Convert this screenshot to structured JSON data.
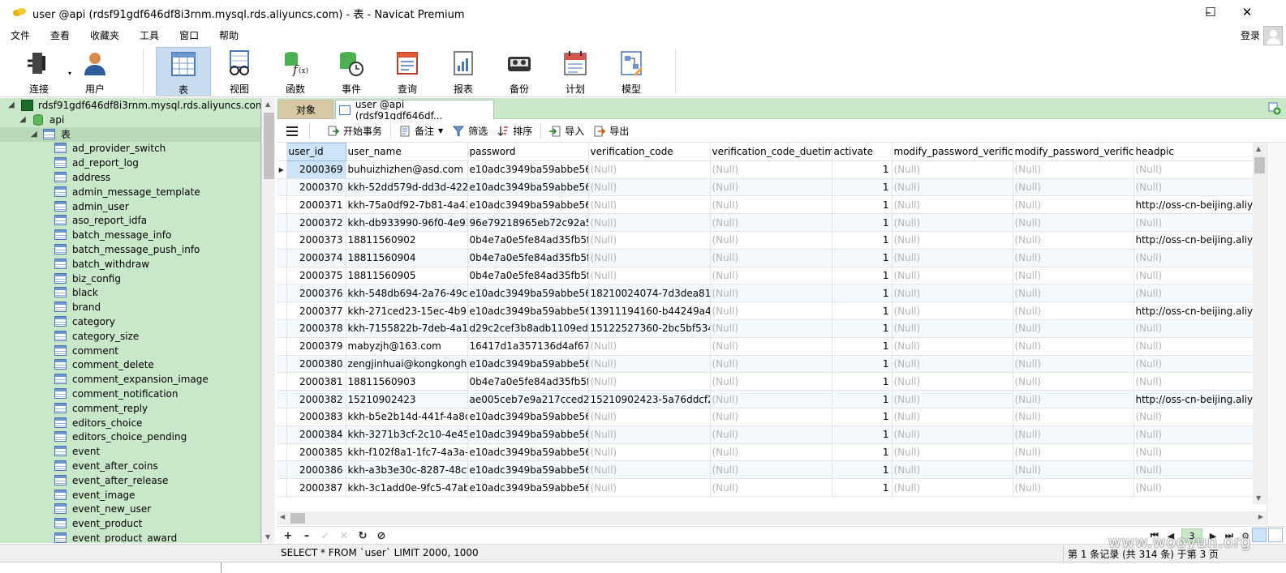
{
  "window": {
    "title": "user @api (rdsf91gdf646df8i3rnm.mysql.rds.aliyuncs.com) - 表 - Navicat Premium"
  },
  "menu": [
    "文件",
    "查看",
    "收藏夹",
    "工具",
    "窗口",
    "帮助"
  ],
  "login_label": "登录",
  "toolbar": [
    {
      "label": "连接",
      "icon": "plug-icon"
    },
    {
      "label": "用户",
      "icon": "user-icon"
    },
    {
      "label": "表",
      "icon": "table-icon",
      "active": true
    },
    {
      "label": "视图",
      "icon": "view-glasses-icon"
    },
    {
      "label": "函数",
      "icon": "function-icon"
    },
    {
      "label": "事件",
      "icon": "event-clock-icon"
    },
    {
      "label": "查询",
      "icon": "query-icon"
    },
    {
      "label": "报表",
      "icon": "report-icon"
    },
    {
      "label": "备份",
      "icon": "backup-icon"
    },
    {
      "label": "计划",
      "icon": "schedule-icon"
    },
    {
      "label": "模型",
      "icon": "model-icon"
    }
  ],
  "sidebar": {
    "connection": "rdsf91gdf646df8i3rnm.mysql.rds.aliyuncs.com",
    "database": "api",
    "group": "表",
    "tables": [
      "ad_provider_switch",
      "ad_report_log",
      "address",
      "admin_message_template",
      "admin_user",
      "aso_report_idfa",
      "batch_message_info",
      "batch_message_push_info",
      "batch_withdraw",
      "biz_config",
      "black",
      "brand",
      "category",
      "category_size",
      "comment",
      "comment_delete",
      "comment_expansion_image",
      "comment_notification",
      "comment_reply",
      "editors_choice",
      "editors_choice_pending",
      "event",
      "event_after_coins",
      "event_after_release",
      "event_image",
      "event_new_user",
      "event_product",
      "event_product_award"
    ]
  },
  "tabs": {
    "objects": "对象",
    "current": "user @api (rdsf91gdf646df..."
  },
  "subtoolbar": {
    "begin_transaction": "开始事务",
    "note": "备注",
    "filter": "筛选",
    "sort": "排序",
    "import": "导入",
    "export": "导出"
  },
  "grid": {
    "columns": [
      "user_id",
      "user_name",
      "password",
      "verification_code",
      "verification_code_duetime",
      "activate",
      "modify_password_verifica",
      "modify_password_verifica",
      "headpic"
    ],
    "null_text": "(Null)",
    "rows": [
      [
        "2000369",
        "buhuizhizhen@asd.com",
        "e10adc3949ba59abbe56e",
        null,
        null,
        "1",
        null,
        null,
        null
      ],
      [
        "2000370",
        "kkh-52dd579d-dd3d-422",
        "e10adc3949ba59abbe56e",
        null,
        null,
        "1",
        null,
        null,
        null
      ],
      [
        "2000371",
        "kkh-75a0df92-7b81-4a43",
        "e10adc3949ba59abbe56e",
        null,
        null,
        "1",
        null,
        null,
        "http://oss-cn-beijing.aliyu"
      ],
      [
        "2000372",
        "kkh-db933990-96f0-4e91",
        "96e79218965eb72c92a54",
        null,
        null,
        "1",
        null,
        null,
        null
      ],
      [
        "2000373",
        "18811560902",
        "0b4e7a0e5fe84ad35fb5f9",
        null,
        null,
        "1",
        null,
        null,
        "http://oss-cn-beijing.aliyu"
      ],
      [
        "2000374",
        "18811560904",
        "0b4e7a0e5fe84ad35fb5f9",
        null,
        null,
        "1",
        null,
        null,
        null
      ],
      [
        "2000375",
        "18811560905",
        "0b4e7a0e5fe84ad35fb5f9",
        null,
        null,
        "1",
        null,
        null,
        null
      ],
      [
        "2000376",
        "kkh-548db694-2a76-49c7",
        "e10adc3949ba59abbe56e",
        "18210024074-7d3dea816",
        null,
        "1",
        null,
        null,
        null
      ],
      [
        "2000377",
        "kkh-271ced23-15ec-4b95",
        "e10adc3949ba59abbe56e",
        "13911194160-b44249a4b",
        null,
        "1",
        null,
        null,
        "http://oss-cn-beijing.aliyu"
      ],
      [
        "2000378",
        "kkh-7155822b-7deb-4a1f",
        "d29c2cef3b8adb1109ed1",
        "15122527360-2bc5bf5343",
        null,
        "1",
        null,
        null,
        null
      ],
      [
        "2000379",
        "mabyzjh@163.com",
        "16417d1a357136d4af670",
        null,
        null,
        "1",
        null,
        null,
        null
      ],
      [
        "2000380",
        "zengjinhuai@kongkonghu",
        "e10adc3949ba59abbe56e",
        null,
        null,
        "1",
        null,
        null,
        null
      ],
      [
        "2000381",
        "18811560903",
        "0b4e7a0e5fe84ad35fb5f9",
        null,
        null,
        "1",
        null,
        null,
        null
      ],
      [
        "2000382",
        "15210902423",
        "ae005ceb7e9a217cced2f8",
        "15210902423-5a76ddcf26",
        null,
        "1",
        null,
        null,
        "http://oss-cn-beijing.aliyu"
      ],
      [
        "2000383",
        "kkh-b5e2b14d-441f-4a8d",
        "e10adc3949ba59abbe56e",
        null,
        null,
        "1",
        null,
        null,
        null
      ],
      [
        "2000384",
        "kkh-3271b3cf-2c10-4e45-",
        "e10adc3949ba59abbe56e",
        null,
        null,
        "1",
        null,
        null,
        null
      ],
      [
        "2000385",
        "kkh-f102f8a1-1fc7-4a3a-9",
        "e10adc3949ba59abbe56e",
        null,
        null,
        "1",
        null,
        null,
        null
      ],
      [
        "2000386",
        "kkh-a3b3e30c-8287-48cf-",
        "e10adc3949ba59abbe56e",
        null,
        null,
        "1",
        null,
        null,
        null
      ],
      [
        "2000387",
        "kkh-3c1add0e-9fc5-47ab-",
        "e10adc3949ba59abbe56e",
        null,
        null,
        "1",
        null,
        null,
        null
      ]
    ]
  },
  "pager": {
    "page": "3"
  },
  "status": {
    "sql": "SELECT * FROM `user` LIMIT 2000, 1000",
    "records": "第 1 条记录 (共 314 条) 于第 3 页"
  },
  "watermark": "www.wooyun.org",
  "below_fragment": "                                          "
}
